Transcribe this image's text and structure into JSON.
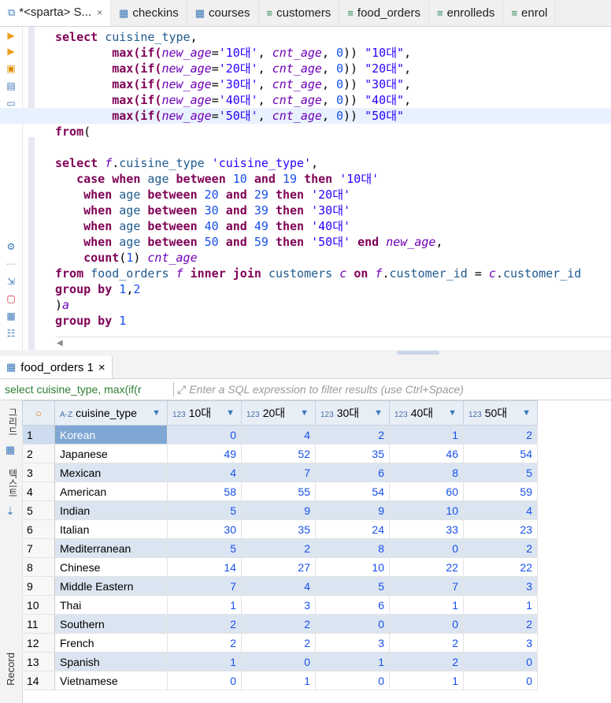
{
  "tabs": [
    {
      "label": "*<sparta> S...",
      "icon": "sql-editor-icon",
      "active": true,
      "closable": true
    },
    {
      "label": "checkins",
      "icon": "table-icon"
    },
    {
      "label": "courses",
      "icon": "table-icon"
    },
    {
      "label": "customers",
      "icon": "view-icon"
    },
    {
      "label": "food_orders",
      "icon": "view-icon"
    },
    {
      "label": "enrolleds",
      "icon": "view-icon"
    },
    {
      "label": "enrol",
      "icon": "view-icon"
    }
  ],
  "results_tab": {
    "label": "food_orders 1",
    "close": "×"
  },
  "filter": {
    "sql_label": "select cuisine_type, max(if(r",
    "placeholder": "Enter a SQL expression to filter results (use Ctrl+Space)"
  },
  "side_labels": {
    "grid": "그리드",
    "text": "텍스트",
    "record": "Record"
  },
  "grid": {
    "columns": [
      {
        "type": "A-Z",
        "name": "cuisine_type"
      },
      {
        "type": "123",
        "name": "10대"
      },
      {
        "type": "123",
        "name": "20대"
      },
      {
        "type": "123",
        "name": "30대"
      },
      {
        "type": "123",
        "name": "40대"
      },
      {
        "type": "123",
        "name": "50대"
      }
    ],
    "rows": [
      {
        "n": "1",
        "c": [
          "Korean",
          "0",
          "4",
          "2",
          "1",
          "2"
        ]
      },
      {
        "n": "2",
        "c": [
          "Japanese",
          "49",
          "52",
          "35",
          "46",
          "54"
        ]
      },
      {
        "n": "3",
        "c": [
          "Mexican",
          "4",
          "7",
          "6",
          "8",
          "5"
        ]
      },
      {
        "n": "4",
        "c": [
          "American",
          "58",
          "55",
          "54",
          "60",
          "59"
        ]
      },
      {
        "n": "5",
        "c": [
          "Indian",
          "5",
          "9",
          "9",
          "10",
          "4"
        ]
      },
      {
        "n": "6",
        "c": [
          "Italian",
          "30",
          "35",
          "24",
          "33",
          "23"
        ]
      },
      {
        "n": "7",
        "c": [
          "Mediterranean",
          "5",
          "2",
          "8",
          "0",
          "2"
        ]
      },
      {
        "n": "8",
        "c": [
          "Chinese",
          "14",
          "27",
          "10",
          "22",
          "22"
        ]
      },
      {
        "n": "9",
        "c": [
          "Middle Eastern",
          "7",
          "4",
          "5",
          "7",
          "3"
        ]
      },
      {
        "n": "10",
        "c": [
          "Thai",
          "1",
          "3",
          "6",
          "1",
          "1"
        ]
      },
      {
        "n": "11",
        "c": [
          "Southern",
          "2",
          "2",
          "0",
          "0",
          "2"
        ]
      },
      {
        "n": "12",
        "c": [
          "French",
          "2",
          "2",
          "3",
          "2",
          "3"
        ]
      },
      {
        "n": "13",
        "c": [
          "Spanish",
          "1",
          "0",
          "1",
          "2",
          "0"
        ]
      },
      {
        "n": "14",
        "c": [
          "Vietnamese",
          "0",
          "1",
          "0",
          "1",
          "0"
        ]
      }
    ]
  },
  "code_lines": [
    [
      {
        "t": "kw",
        "v": "select"
      },
      {
        "t": "",
        "v": " "
      },
      {
        "t": "id",
        "v": "cuisine_type"
      },
      {
        "t": "",
        "v": ","
      }
    ],
    [
      {
        "t": "",
        "v": "        "
      },
      {
        "t": "kw",
        "v": "max(if("
      },
      {
        "t": "ali",
        "v": "new_age"
      },
      {
        "t": "",
        "v": "="
      },
      {
        "t": "str",
        "v": "'10대'"
      },
      {
        "t": "",
        "v": ", "
      },
      {
        "t": "ali",
        "v": "cnt_age"
      },
      {
        "t": "",
        "v": ", "
      },
      {
        "t": "num",
        "v": "0"
      },
      {
        "t": "",
        "v": ")) "
      },
      {
        "t": "str",
        "v": "\"10대\""
      },
      {
        "t": "",
        "v": ","
      }
    ],
    [
      {
        "t": "",
        "v": "        "
      },
      {
        "t": "kw",
        "v": "max(if("
      },
      {
        "t": "ali",
        "v": "new_age"
      },
      {
        "t": "",
        "v": "="
      },
      {
        "t": "str",
        "v": "'20대'"
      },
      {
        "t": "",
        "v": ", "
      },
      {
        "t": "ali",
        "v": "cnt_age"
      },
      {
        "t": "",
        "v": ", "
      },
      {
        "t": "num",
        "v": "0"
      },
      {
        "t": "",
        "v": ")) "
      },
      {
        "t": "str",
        "v": "\"20대\""
      },
      {
        "t": "",
        "v": ","
      }
    ],
    [
      {
        "t": "",
        "v": "        "
      },
      {
        "t": "kw",
        "v": "max(if("
      },
      {
        "t": "ali",
        "v": "new_age"
      },
      {
        "t": "",
        "v": "="
      },
      {
        "t": "str",
        "v": "'30대'"
      },
      {
        "t": "",
        "v": ", "
      },
      {
        "t": "ali",
        "v": "cnt_age"
      },
      {
        "t": "",
        "v": ", "
      },
      {
        "t": "num",
        "v": "0"
      },
      {
        "t": "",
        "v": ")) "
      },
      {
        "t": "str",
        "v": "\"30대\""
      },
      {
        "t": "",
        "v": ","
      }
    ],
    [
      {
        "t": "",
        "v": "        "
      },
      {
        "t": "kw",
        "v": "max(if("
      },
      {
        "t": "ali",
        "v": "new_age"
      },
      {
        "t": "",
        "v": "="
      },
      {
        "t": "str",
        "v": "'40대'"
      },
      {
        "t": "",
        "v": ", "
      },
      {
        "t": "ali",
        "v": "cnt_age"
      },
      {
        "t": "",
        "v": ", "
      },
      {
        "t": "num",
        "v": "0"
      },
      {
        "t": "",
        "v": ")) "
      },
      {
        "t": "str",
        "v": "\"40대\""
      },
      {
        "t": "",
        "v": ","
      }
    ],
    [
      {
        "t": "",
        "v": "        "
      },
      {
        "t": "kw",
        "v": "max(if("
      },
      {
        "t": "ali",
        "v": "new_age"
      },
      {
        "t": "",
        "v": "="
      },
      {
        "t": "str",
        "v": "'50대'"
      },
      {
        "t": "",
        "v": ", "
      },
      {
        "t": "ali",
        "v": "cnt_age"
      },
      {
        "t": "",
        "v": ", "
      },
      {
        "t": "num",
        "v": "0"
      },
      {
        "t": "",
        "v": ")) "
      },
      {
        "t": "str",
        "v": "\"50대\""
      }
    ],
    [
      {
        "t": "kw",
        "v": "from"
      },
      {
        "t": "",
        "v": "("
      }
    ],
    [
      {
        "t": "",
        "v": ""
      }
    ],
    [
      {
        "t": "kw",
        "v": "select"
      },
      {
        "t": "",
        "v": " "
      },
      {
        "t": "ali",
        "v": "f"
      },
      {
        "t": "",
        "v": "."
      },
      {
        "t": "id",
        "v": "cuisine_type"
      },
      {
        "t": "",
        "v": " "
      },
      {
        "t": "str",
        "v": "'cuisine_type'"
      },
      {
        "t": "",
        "v": ","
      }
    ],
    [
      {
        "t": "",
        "v": "   "
      },
      {
        "t": "kw",
        "v": "case when"
      },
      {
        "t": "",
        "v": " "
      },
      {
        "t": "id",
        "v": "age"
      },
      {
        "t": "",
        "v": " "
      },
      {
        "t": "kw",
        "v": "between"
      },
      {
        "t": "",
        "v": " "
      },
      {
        "t": "num",
        "v": "10"
      },
      {
        "t": "",
        "v": " "
      },
      {
        "t": "kw",
        "v": "and"
      },
      {
        "t": "",
        "v": " "
      },
      {
        "t": "num",
        "v": "19"
      },
      {
        "t": "",
        "v": " "
      },
      {
        "t": "kw",
        "v": "then"
      },
      {
        "t": "",
        "v": " "
      },
      {
        "t": "str",
        "v": "'10대'"
      }
    ],
    [
      {
        "t": "",
        "v": "    "
      },
      {
        "t": "kw",
        "v": "when"
      },
      {
        "t": "",
        "v": " "
      },
      {
        "t": "id",
        "v": "age"
      },
      {
        "t": "",
        "v": " "
      },
      {
        "t": "kw",
        "v": "between"
      },
      {
        "t": "",
        "v": " "
      },
      {
        "t": "num",
        "v": "20"
      },
      {
        "t": "",
        "v": " "
      },
      {
        "t": "kw",
        "v": "and"
      },
      {
        "t": "",
        "v": " "
      },
      {
        "t": "num",
        "v": "29"
      },
      {
        "t": "",
        "v": " "
      },
      {
        "t": "kw",
        "v": "then"
      },
      {
        "t": "",
        "v": " "
      },
      {
        "t": "str",
        "v": "'20대'"
      }
    ],
    [
      {
        "t": "",
        "v": "    "
      },
      {
        "t": "kw",
        "v": "when"
      },
      {
        "t": "",
        "v": " "
      },
      {
        "t": "id",
        "v": "age"
      },
      {
        "t": "",
        "v": " "
      },
      {
        "t": "kw",
        "v": "between"
      },
      {
        "t": "",
        "v": " "
      },
      {
        "t": "num",
        "v": "30"
      },
      {
        "t": "",
        "v": " "
      },
      {
        "t": "kw",
        "v": "and"
      },
      {
        "t": "",
        "v": " "
      },
      {
        "t": "num",
        "v": "39"
      },
      {
        "t": "",
        "v": " "
      },
      {
        "t": "kw",
        "v": "then"
      },
      {
        "t": "",
        "v": " "
      },
      {
        "t": "str",
        "v": "'30대'"
      }
    ],
    [
      {
        "t": "",
        "v": "    "
      },
      {
        "t": "kw",
        "v": "when"
      },
      {
        "t": "",
        "v": " "
      },
      {
        "t": "id",
        "v": "age"
      },
      {
        "t": "",
        "v": " "
      },
      {
        "t": "kw",
        "v": "between"
      },
      {
        "t": "",
        "v": " "
      },
      {
        "t": "num",
        "v": "40"
      },
      {
        "t": "",
        "v": " "
      },
      {
        "t": "kw",
        "v": "and"
      },
      {
        "t": "",
        "v": " "
      },
      {
        "t": "num",
        "v": "49"
      },
      {
        "t": "",
        "v": " "
      },
      {
        "t": "kw",
        "v": "then"
      },
      {
        "t": "",
        "v": " "
      },
      {
        "t": "str",
        "v": "'40대'"
      }
    ],
    [
      {
        "t": "",
        "v": "    "
      },
      {
        "t": "kw",
        "v": "when"
      },
      {
        "t": "",
        "v": " "
      },
      {
        "t": "id",
        "v": "age"
      },
      {
        "t": "",
        "v": " "
      },
      {
        "t": "kw",
        "v": "between"
      },
      {
        "t": "",
        "v": " "
      },
      {
        "t": "num",
        "v": "50"
      },
      {
        "t": "",
        "v": " "
      },
      {
        "t": "kw",
        "v": "and"
      },
      {
        "t": "",
        "v": " "
      },
      {
        "t": "num",
        "v": "59"
      },
      {
        "t": "",
        "v": " "
      },
      {
        "t": "kw",
        "v": "then"
      },
      {
        "t": "",
        "v": " "
      },
      {
        "t": "str",
        "v": "'50대'"
      },
      {
        "t": "",
        "v": " "
      },
      {
        "t": "kw",
        "v": "end"
      },
      {
        "t": "",
        "v": " "
      },
      {
        "t": "ali",
        "v": "new_age"
      },
      {
        "t": "",
        "v": ","
      }
    ],
    [
      {
        "t": "",
        "v": "    "
      },
      {
        "t": "kw",
        "v": "count"
      },
      {
        "t": "",
        "v": "("
      },
      {
        "t": "num",
        "v": "1"
      },
      {
        "t": "",
        "v": ") "
      },
      {
        "t": "ali",
        "v": "cnt_age"
      }
    ],
    [
      {
        "t": "kw",
        "v": "from"
      },
      {
        "t": "",
        "v": " "
      },
      {
        "t": "id",
        "v": "food_orders"
      },
      {
        "t": "",
        "v": " "
      },
      {
        "t": "ali",
        "v": "f"
      },
      {
        "t": "",
        "v": " "
      },
      {
        "t": "kw",
        "v": "inner join"
      },
      {
        "t": "",
        "v": " "
      },
      {
        "t": "id",
        "v": "customers"
      },
      {
        "t": "",
        "v": " "
      },
      {
        "t": "ali",
        "v": "c"
      },
      {
        "t": "",
        "v": " "
      },
      {
        "t": "kw",
        "v": "on"
      },
      {
        "t": "",
        "v": " "
      },
      {
        "t": "ali",
        "v": "f"
      },
      {
        "t": "",
        "v": "."
      },
      {
        "t": "id",
        "v": "customer_id"
      },
      {
        "t": "",
        "v": " = "
      },
      {
        "t": "ali",
        "v": "c"
      },
      {
        "t": "",
        "v": "."
      },
      {
        "t": "id",
        "v": "customer_id"
      }
    ],
    [
      {
        "t": "kw",
        "v": "group by"
      },
      {
        "t": "",
        "v": " "
      },
      {
        "t": "num",
        "v": "1"
      },
      {
        "t": "",
        "v": ","
      },
      {
        "t": "num",
        "v": "2"
      }
    ],
    [
      {
        "t": "",
        "v": ")"
      },
      {
        "t": "ali",
        "v": "a"
      }
    ],
    [
      {
        "t": "kw",
        "v": "group by"
      },
      {
        "t": "",
        "v": " "
      },
      {
        "t": "num",
        "v": "1"
      }
    ]
  ]
}
